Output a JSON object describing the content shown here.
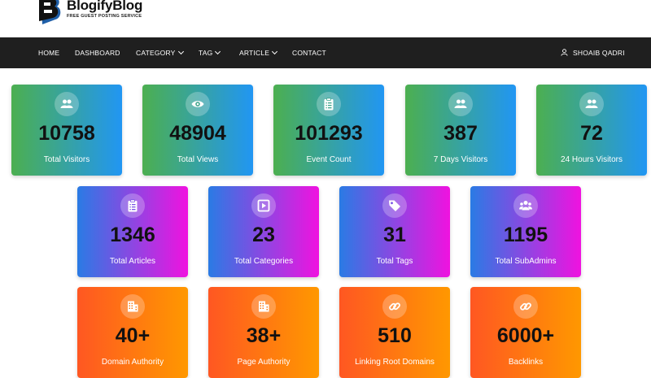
{
  "brand": {
    "name": "BlogifyBlog",
    "tagline": "FREE GUEST POSTING SERVICE"
  },
  "nav": {
    "items": [
      {
        "label": "HOME",
        "dropdown": false
      },
      {
        "label": "DASHBOARD",
        "dropdown": false
      },
      {
        "label": "CATEGORY",
        "dropdown": true
      },
      {
        "label": "TAG",
        "dropdown": true
      },
      {
        "label": "ARTICLE",
        "dropdown": true
      },
      {
        "label": "CONTACT",
        "dropdown": false
      }
    ],
    "user": "SHOAIB QADRI"
  },
  "stats": [
    {
      "value": "10758",
      "label": "Total Visitors",
      "icon": "users-icon"
    },
    {
      "value": "48904",
      "label": "Total Views",
      "icon": "eye-icon"
    },
    {
      "value": "101293",
      "label": "Event Count",
      "icon": "clipboard-icon"
    },
    {
      "value": "387",
      "label": "7 Days Visitors",
      "icon": "users-icon"
    },
    {
      "value": "72",
      "label": "24 Hours Visitors",
      "icon": "users-icon"
    },
    {
      "value": "1346",
      "label": "Total Articles",
      "icon": "clipboard-icon"
    },
    {
      "value": "23",
      "label": "Total Categories",
      "icon": "play-square-icon"
    },
    {
      "value": "31",
      "label": "Total Tags",
      "icon": "tag-icon"
    },
    {
      "value": "1195",
      "label": "Total SubAdmins",
      "icon": "user-group-icon"
    },
    {
      "value": "40+",
      "label": "Domain Authority",
      "icon": "building-icon"
    },
    {
      "value": "38+",
      "label": "Page Authority",
      "icon": "building-icon"
    },
    {
      "value": "510",
      "label": "Linking Root Domains",
      "icon": "link-icon"
    },
    {
      "value": "6000+",
      "label": "Backlinks",
      "icon": "link-icon"
    }
  ]
}
